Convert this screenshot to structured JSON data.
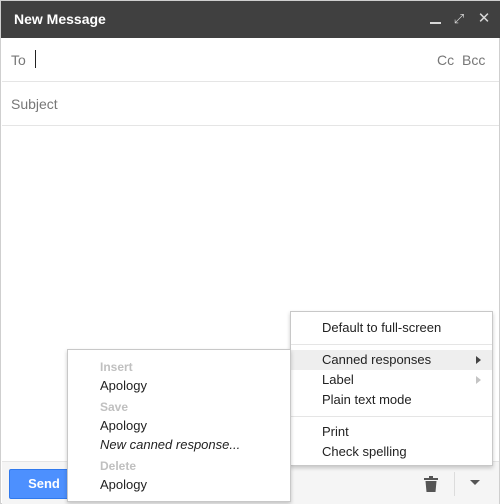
{
  "window": {
    "title": "New Message",
    "controls": {
      "minimize": "minimize-icon",
      "expand": "expand-icon",
      "close": "close-icon",
      "expand_glyph": "⤢",
      "close_glyph": "✕"
    }
  },
  "fields": {
    "to_label": "To",
    "to_value": "",
    "cc_label": "Cc",
    "bcc_label": "Bcc",
    "subject_placeholder": "Subject",
    "body": ""
  },
  "toolbar": {
    "send_label": "Send",
    "trash_icon": "trash-icon",
    "more_icon": "chevron-down-icon"
  },
  "more_menu": {
    "items": [
      {
        "label": "Default to full-screen"
      },
      {
        "label": "Canned responses",
        "has_submenu": true,
        "highlighted": true
      },
      {
        "label": "Label",
        "has_submenu": true
      },
      {
        "label": "Plain text mode"
      },
      {
        "label": "Print"
      },
      {
        "label": "Check spelling"
      }
    ]
  },
  "canned_menu": {
    "insert_header": "Insert",
    "insert_items": [
      "Apology"
    ],
    "save_header": "Save",
    "save_items": [
      "Apology",
      "New canned response..."
    ],
    "delete_header": "Delete",
    "delete_items": [
      "Apology"
    ]
  },
  "colors": {
    "titlebar": "#404040",
    "send_button": "#4d90fe",
    "menu_highlight": "#eeeeee",
    "header_disabled": "#c0c0c0"
  }
}
